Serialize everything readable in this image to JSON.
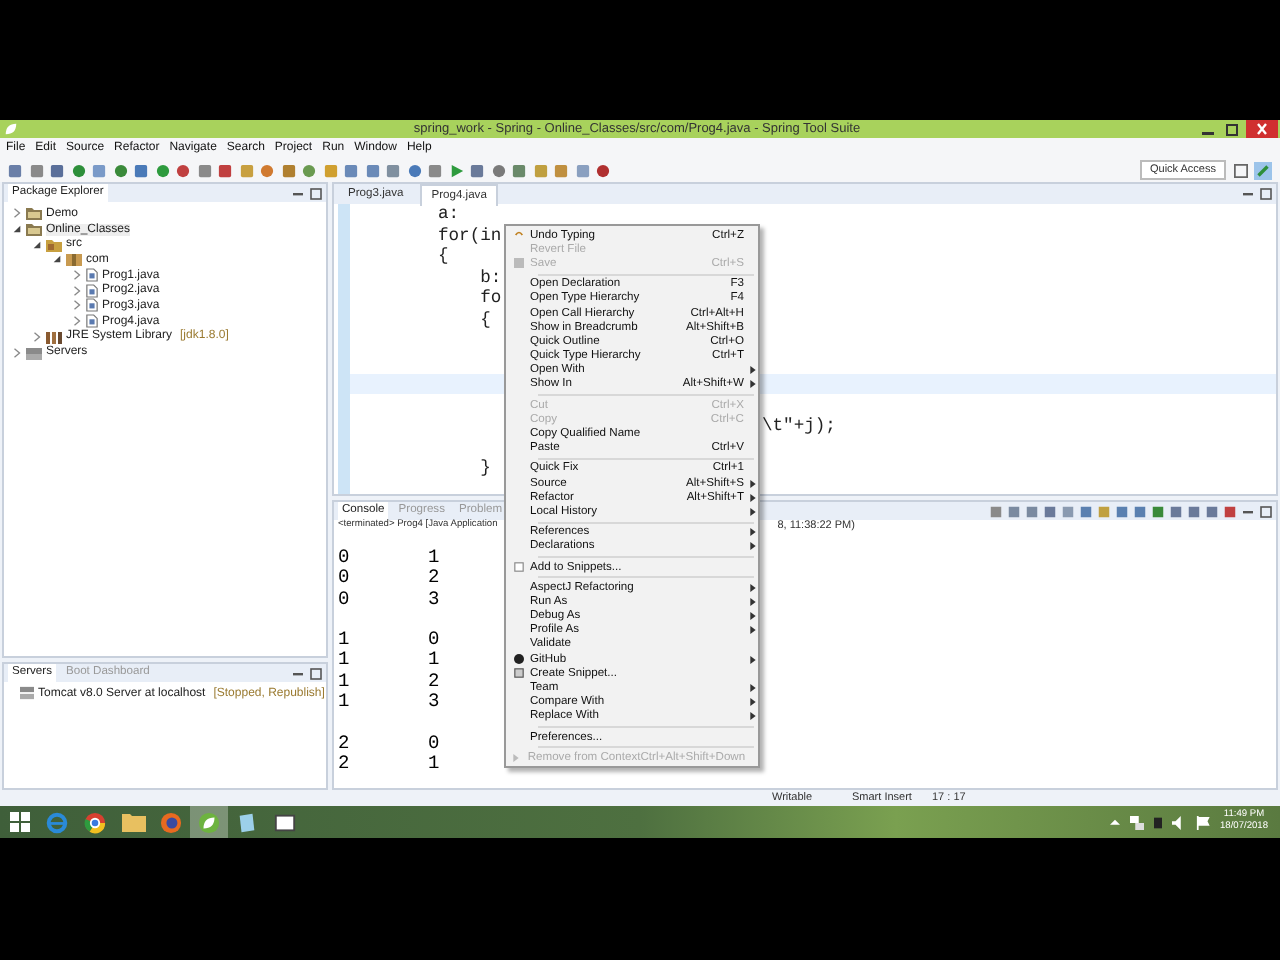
{
  "window": {
    "title": "spring_work - Spring - Online_Classes/src/com/Prog4.java - Spring Tool Suite"
  },
  "menu_bar": [
    "File",
    "Edit",
    "Source",
    "Refactor",
    "Navigate",
    "Search",
    "Project",
    "Run",
    "Window",
    "Help"
  ],
  "quick_access": {
    "label": "Quick Access"
  },
  "package_explorer": {
    "title": "Package Explorer",
    "tree": [
      {
        "kind": "project",
        "label": "Demo",
        "expanded": false,
        "selected": false
      },
      {
        "kind": "project",
        "label": "Online_Classes",
        "expanded": true,
        "selected": true,
        "children": [
          {
            "kind": "source_folder",
            "label": "src",
            "expanded": true,
            "selected": false,
            "children": [
              {
                "kind": "package",
                "label": "com",
                "expanded": true,
                "selected": false,
                "children": [
                  {
                    "kind": "java_file",
                    "label": "Prog1.java",
                    "expanded": false,
                    "selected": false
                  },
                  {
                    "kind": "java_file",
                    "label": "Prog2.java",
                    "expanded": false,
                    "selected": false
                  },
                  {
                    "kind": "java_file",
                    "label": "Prog3.java",
                    "expanded": false,
                    "selected": false
                  },
                  {
                    "kind": "java_file",
                    "label": "Prog4.java",
                    "expanded": false,
                    "selected": false
                  }
                ]
              }
            ]
          },
          {
            "kind": "library",
            "label": "JRE System Library",
            "suffix": "[jdk1.8.0]",
            "expanded": false,
            "selected": false
          }
        ]
      },
      {
        "kind": "servers",
        "label": "Servers",
        "expanded": false,
        "selected": false
      }
    ]
  },
  "servers_view": {
    "tabs": [
      {
        "label": "Servers",
        "selected": true
      },
      {
        "label": "Boot Dashboard",
        "selected": false
      }
    ],
    "items": [
      {
        "name": "Tomcat v8.0 Server at localhost",
        "status": "[Stopped, Republish]"
      }
    ]
  },
  "editor": {
    "tabs": [
      {
        "label": "Prog3.java",
        "selected": false
      },
      {
        "label": "Prog4.java",
        "selected": true
      }
    ],
    "lines": [
      {
        "kind": "code",
        "text": "a:",
        "current": false
      },
      {
        "kind": "code",
        "text": "for(in",
        "current": false
      },
      {
        "kind": "code",
        "text": "{",
        "current": false
      },
      {
        "kind": "code",
        "text": "    b:",
        "current": false
      },
      {
        "kind": "code",
        "text": "    fo",
        "current": false
      },
      {
        "kind": "code",
        "text": "    {",
        "current": false
      },
      {
        "kind": "code",
        "current": false
      },
      {
        "kind": "code",
        "current": false
      },
      {
        "kind": "code",
        "current": true
      },
      {
        "kind": "code",
        "current": false
      },
      {
        "kind": "clipped",
        "text": "\\t\"+j);",
        "current": false
      },
      {
        "kind": "code",
        "current": false
      },
      {
        "kind": "code",
        "text": "    }",
        "current": false
      }
    ]
  },
  "console": {
    "tabs": [
      {
        "label": "Console",
        "selected": true
      },
      {
        "label": "Progress",
        "selected": false
      },
      {
        "label": "Problem",
        "selected": false
      }
    ],
    "launch": "<terminated> Prog4 [Java Application",
    "launch_tail": "8, 11:38:22 PM)",
    "groups": [
      [
        [
          "0",
          "1"
        ],
        [
          "0",
          "2"
        ],
        [
          "0",
          "3"
        ]
      ],
      [
        [
          "1",
          "0"
        ],
        [
          "1",
          "1"
        ],
        [
          "1",
          "2"
        ],
        [
          "1",
          "3"
        ]
      ],
      [
        [
          "2",
          "0"
        ],
        [
          "2",
          "1"
        ]
      ]
    ]
  },
  "context_menu": {
    "items": [
      {
        "kind": "item",
        "label": "Undo Typing",
        "shortcut": "Ctrl+Z",
        "disabled": false,
        "submenu": false
      },
      {
        "kind": "item",
        "label": "Revert File",
        "disabled": true,
        "submenu": false
      },
      {
        "kind": "item",
        "label": "Save",
        "shortcut": "Ctrl+S",
        "disabled": true,
        "submenu": false
      },
      {
        "kind": "separator"
      },
      {
        "kind": "item",
        "label": "Open Declaration",
        "shortcut": "F3",
        "disabled": false,
        "submenu": false
      },
      {
        "kind": "item",
        "label": "Open Type Hierarchy",
        "shortcut": "F4",
        "disabled": false,
        "submenu": false
      },
      {
        "kind": "item",
        "label": "Open Call Hierarchy",
        "shortcut": "Ctrl+Alt+H",
        "disabled": false,
        "submenu": false
      },
      {
        "kind": "item",
        "label": "Show in Breadcrumb",
        "shortcut": "Alt+Shift+B",
        "disabled": false,
        "submenu": false
      },
      {
        "kind": "item",
        "label": "Quick Outline",
        "shortcut": "Ctrl+O",
        "disabled": false,
        "submenu": false
      },
      {
        "kind": "item",
        "label": "Quick Type Hierarchy",
        "shortcut": "Ctrl+T",
        "disabled": false,
        "submenu": false
      },
      {
        "kind": "item",
        "label": "Open With",
        "disabled": false,
        "submenu": true
      },
      {
        "kind": "item",
        "label": "Show In",
        "shortcut": "Alt+Shift+W",
        "disabled": false,
        "submenu": true
      },
      {
        "kind": "separator"
      },
      {
        "kind": "item",
        "label": "Cut",
        "shortcut": "Ctrl+X",
        "disabled": true,
        "submenu": false
      },
      {
        "kind": "item",
        "label": "Copy",
        "shortcut": "Ctrl+C",
        "disabled": true,
        "submenu": false
      },
      {
        "kind": "item",
        "label": "Copy Qualified Name",
        "disabled": false,
        "submenu": false
      },
      {
        "kind": "item",
        "label": "Paste",
        "shortcut": "Ctrl+V",
        "disabled": false,
        "submenu": false
      },
      {
        "kind": "separator"
      },
      {
        "kind": "item",
        "label": "Quick Fix",
        "shortcut": "Ctrl+1",
        "disabled": false,
        "submenu": false
      },
      {
        "kind": "item",
        "label": "Source",
        "shortcut": "Alt+Shift+S",
        "disabled": false,
        "submenu": true
      },
      {
        "kind": "item",
        "label": "Refactor",
        "shortcut": "Alt+Shift+T",
        "disabled": false,
        "submenu": true
      },
      {
        "kind": "item",
        "label": "Local History",
        "disabled": false,
        "submenu": true
      },
      {
        "kind": "separator"
      },
      {
        "kind": "item",
        "label": "References",
        "disabled": false,
        "submenu": true
      },
      {
        "kind": "item",
        "label": "Declarations",
        "disabled": false,
        "submenu": true
      },
      {
        "kind": "separator"
      },
      {
        "kind": "item",
        "label": "Add to Snippets...",
        "disabled": false,
        "submenu": false
      },
      {
        "kind": "separator"
      },
      {
        "kind": "item",
        "label": "AspectJ Refactoring",
        "disabled": false,
        "submenu": true
      },
      {
        "kind": "item",
        "label": "Run As",
        "disabled": false,
        "submenu": true
      },
      {
        "kind": "item",
        "label": "Debug As",
        "disabled": false,
        "submenu": true
      },
      {
        "kind": "item",
        "label": "Profile As",
        "disabled": false,
        "submenu": true
      },
      {
        "kind": "item",
        "label": "Validate",
        "disabled": false,
        "submenu": false
      },
      {
        "kind": "item",
        "label": "GitHub",
        "disabled": false,
        "submenu": true
      },
      {
        "kind": "item",
        "label": "Create Snippet...",
        "disabled": false,
        "submenu": false
      },
      {
        "kind": "item",
        "label": "Team",
        "disabled": false,
        "submenu": true
      },
      {
        "kind": "item",
        "label": "Compare With",
        "disabled": false,
        "submenu": true
      },
      {
        "kind": "item",
        "label": "Replace With",
        "disabled": false,
        "submenu": true
      },
      {
        "kind": "separator"
      },
      {
        "kind": "item",
        "label": "Preferences...",
        "disabled": false,
        "submenu": false
      },
      {
        "kind": "separator"
      },
      {
        "kind": "item",
        "label": "Remove from Context",
        "shortcut": "Ctrl+Alt+Shift+Down",
        "disabled": true,
        "submenu": false
      }
    ]
  },
  "status_bar": [
    "Writable",
    "Smart Insert",
    "17 : 17"
  ],
  "taskbar": {
    "apps": [
      {
        "kind": "start",
        "selected": false
      },
      {
        "kind": "ie",
        "selected": false
      },
      {
        "kind": "chrome",
        "selected": false
      },
      {
        "kind": "explorer",
        "selected": false
      },
      {
        "kind": "firefox",
        "selected": false
      },
      {
        "kind": "spring",
        "selected": true
      },
      {
        "kind": "notepad",
        "selected": false
      },
      {
        "kind": "video",
        "selected": false
      }
    ],
    "time": "11:49 PM",
    "date": "18/07/2018"
  }
}
